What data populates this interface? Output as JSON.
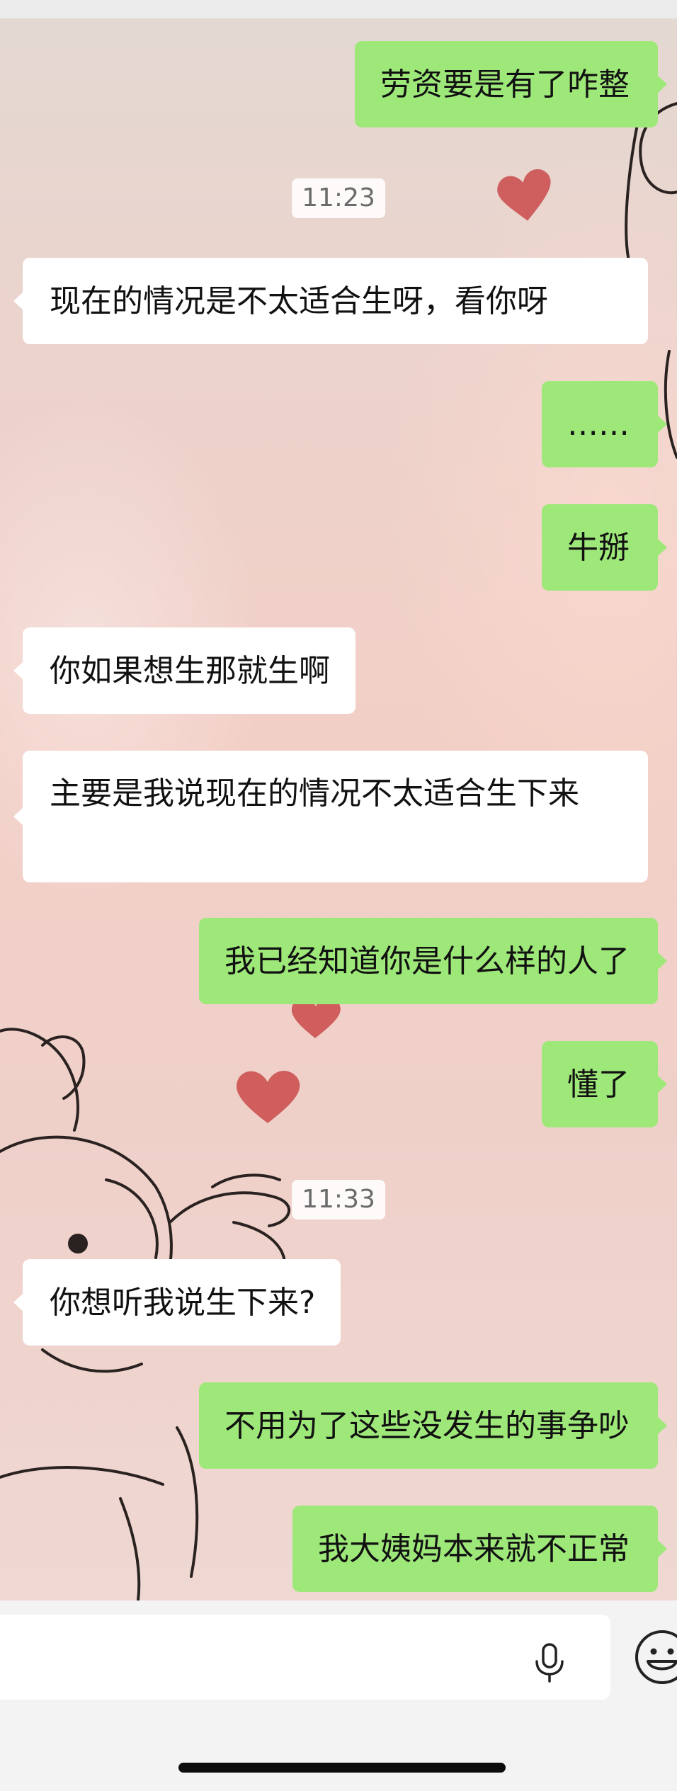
{
  "conversation": [
    {
      "kind": "message",
      "side": "out",
      "text": "劳资要是有了咋整"
    },
    {
      "kind": "time",
      "text": "11:23"
    },
    {
      "kind": "message",
      "side": "in",
      "text": "现在的情况是不太适合生呀，看你呀"
    },
    {
      "kind": "message",
      "side": "out",
      "text": "……"
    },
    {
      "kind": "message",
      "side": "out",
      "text": "牛掰"
    },
    {
      "kind": "message",
      "side": "in",
      "text": "你如果想生那就生啊"
    },
    {
      "kind": "message",
      "side": "in",
      "text": "主要是我说现在的情况不太适合生下来"
    },
    {
      "kind": "message",
      "side": "out",
      "text": "我已经知道你是什么样的人了"
    },
    {
      "kind": "message",
      "side": "out",
      "text": "懂了"
    },
    {
      "kind": "time",
      "text": "11:33"
    },
    {
      "kind": "message",
      "side": "in",
      "text": "你想听我说生下来?"
    },
    {
      "kind": "message",
      "side": "out",
      "text": "不用为了这些没发生的事争吵"
    },
    {
      "kind": "message",
      "side": "out",
      "text": "我大姨妈本来就不正常"
    }
  ],
  "input_bar": {
    "mic_icon": "microphone-icon",
    "emoji_icon": "emoji-icon"
  },
  "colors": {
    "outgoing_bubble": "#9ee87a",
    "incoming_bubble": "#ffffff",
    "timestamp_text": "#6b6b6b"
  }
}
